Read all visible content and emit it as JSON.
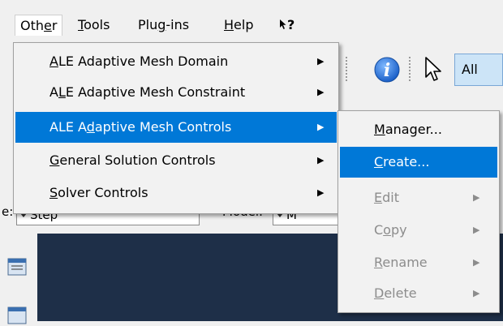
{
  "menubar": {
    "items": [
      {
        "pre": "Oth",
        "u": "e",
        "post": "r"
      },
      {
        "pre": "",
        "u": "T",
        "post": "ools"
      },
      {
        "pre": "Plu",
        "u": "g",
        "post": "-ins"
      },
      {
        "pre": "",
        "u": "H",
        "post": "elp"
      }
    ],
    "whats_this": "?"
  },
  "toolbar": {
    "select_filter": "All"
  },
  "context": {
    "step_label": "e:",
    "step_value": "Step",
    "model_label": "Model:",
    "model_value": "M"
  },
  "other_menu": {
    "items": [
      {
        "pre": "",
        "u": "A",
        "post": "LE Adaptive Mesh Domain"
      },
      {
        "pre": "A",
        "u": "L",
        "post": "E Adaptive Mesh Constraint"
      },
      {
        "pre": "ALE A",
        "u": "d",
        "post": "aptive Mesh Controls"
      },
      {
        "pre": "",
        "u": "G",
        "post": "eneral Solution Controls"
      },
      {
        "pre": "",
        "u": "S",
        "post": "olver Controls"
      }
    ]
  },
  "controls_submenu": {
    "items": [
      {
        "pre": "",
        "u": "M",
        "post": "anager..."
      },
      {
        "pre": "",
        "u": "C",
        "post": "reate..."
      },
      {
        "pre": "",
        "u": "E",
        "post": "dit"
      },
      {
        "pre": "C",
        "u": "o",
        "post": "py"
      },
      {
        "pre": "",
        "u": "R",
        "post": "ename"
      },
      {
        "pre": "",
        "u": "D",
        "post": "elete"
      }
    ]
  }
}
